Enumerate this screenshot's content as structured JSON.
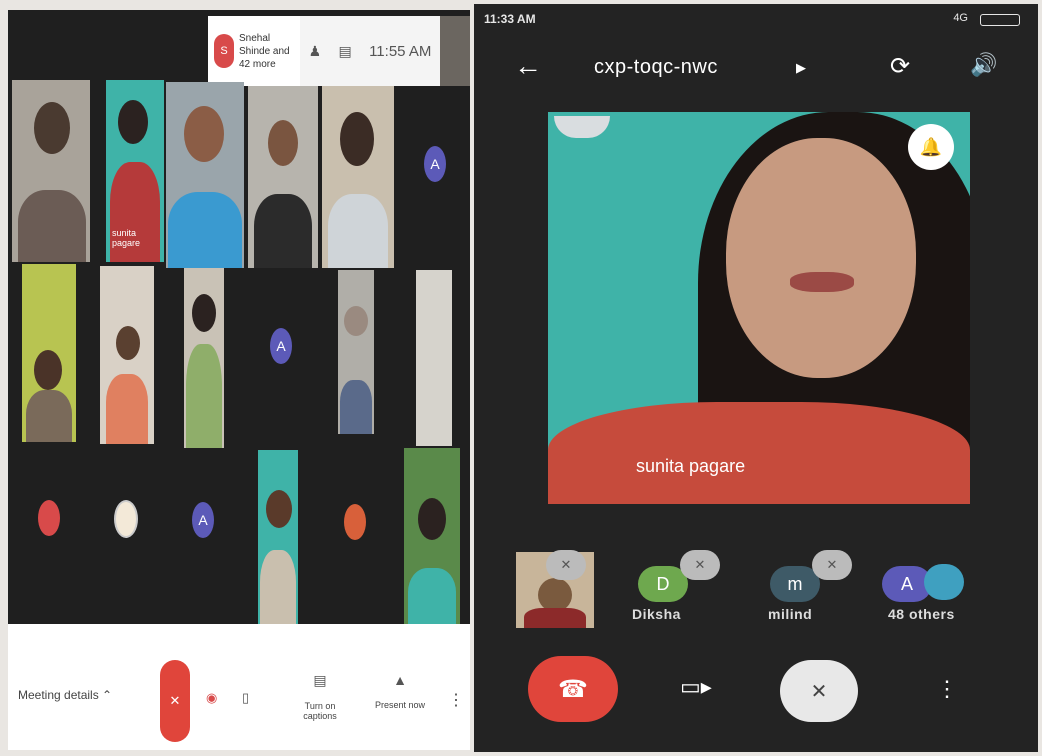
{
  "desktop": {
    "header": {
      "chip_avatar_letter": "S",
      "participants_text": "Snehal Shinde and 42 more",
      "time": "11:55 AM"
    },
    "tile_label": "sunita pagare",
    "avatar_letter": "A",
    "bottom_bar": {
      "meeting_details": "Meeting details",
      "captions_label": "Turn on captions",
      "present_label": "Present now"
    },
    "colors": {
      "hangup": "#e0453b",
      "avatar_purple": "#5c5ab8"
    }
  },
  "mobile": {
    "status_bar": {
      "time": "11:33 AM",
      "network": "4G"
    },
    "app_bar": {
      "meeting_code": "cxp-toqc-nwc"
    },
    "main_speaker": {
      "name": "sunita pagare"
    },
    "participants": [
      {
        "letter": "D",
        "name": "Diksha",
        "color": "#6ea84e"
      },
      {
        "letter": "m",
        "name": "milind",
        "color": "#3e5a67"
      },
      {
        "letter": "A",
        "name": "48 others",
        "color": "#5c5ab8"
      }
    ],
    "icons": {
      "back": "arrow-left-icon",
      "switch_camera": "camera-switch-icon",
      "speaker": "speaker-icon",
      "pin": "pin-icon",
      "end_call": "phone-hangup-icon",
      "video": "video-camera-icon",
      "mute": "mic-off-icon",
      "more": "more-vertical-icon"
    },
    "colors": {
      "end_call": "#e0453b",
      "pin": "#3a7bd5"
    }
  }
}
